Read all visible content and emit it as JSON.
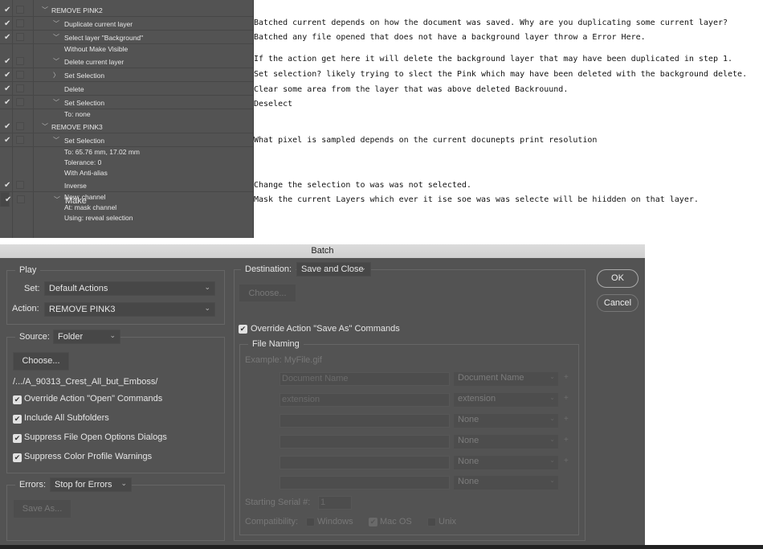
{
  "actions_panel": {
    "rows": [
      {
        "kind": "set",
        "label": "REMOVE PINK2",
        "checked": true,
        "caret": "down"
      },
      {
        "kind": "cmd",
        "label": "Duplicate current layer",
        "checked": true,
        "caret": "down"
      },
      {
        "kind": "cmd",
        "label": "Select layer \"Background\"",
        "checked": true,
        "caret": "down"
      },
      {
        "kind": "det",
        "label": "Without Make Visible"
      },
      {
        "kind": "cmd",
        "label": "Delete current layer",
        "checked": true,
        "caret": "down"
      },
      {
        "kind": "cmd",
        "label": "Set Selection",
        "checked": true,
        "caret": "right"
      },
      {
        "kind": "cmd",
        "label": "Delete",
        "checked": true,
        "caret": ""
      },
      {
        "kind": "cmd",
        "label": "Set Selection",
        "checked": true,
        "caret": "down"
      },
      {
        "kind": "det",
        "label": "To: none"
      },
      {
        "kind": "set",
        "label": "REMOVE PINK3",
        "checked": true,
        "caret": "down"
      },
      {
        "kind": "cmd",
        "label": "Set Selection",
        "checked": true,
        "caret": "down"
      },
      {
        "kind": "det",
        "label": "To: 65.76 mm, 17.02 mm"
      },
      {
        "kind": "det",
        "label": "Tolerance: 0"
      },
      {
        "kind": "det",
        "label": "With Anti-alias"
      },
      {
        "kind": "cmd",
        "label": "Inverse",
        "checked": true,
        "caret": ""
      },
      {
        "kind": "cmd",
        "label": "Make",
        "checked": true,
        "caret": "down",
        "selected": true
      },
      {
        "kind": "det",
        "label": "New: channel"
      },
      {
        "kind": "det",
        "label": "At: mask channel"
      },
      {
        "kind": "det",
        "label": "Using: reveal selection"
      }
    ]
  },
  "notes": [
    "Batched current depends on how the document was saved. Why are you duplicating some current layer?",
    "Batched any file opened that does not have a background layer throw a Error Here.",
    "If the action get here it will delete the background layer that may have been duplicated in step 1.",
    "Set selection? likely trying to slect the Pink which may have been deleted with the background delete.",
    "Clear some area from the layer that was above deleted Backrouund.",
    "Deselect",
    "What pixel is sampled depends on the current docunepts print resolution",
    "Change the selection to was was not selected.",
    "Mask the current Layers  which ever it ise soe was was selecte will be hiidden on that layer."
  ],
  "dialog": {
    "title": "Batch",
    "play": {
      "label": "Play",
      "set_label": "Set:",
      "set_value": "Default Actions",
      "action_label": "Action:",
      "action_value": "REMOVE PINK3"
    },
    "source": {
      "label": "Source:",
      "value": "Folder",
      "choose": "Choose...",
      "path": "/.../A_90313_Crest_All_but_Emboss/",
      "checkboxes": [
        {
          "label": "Override Action \"Open\" Commands",
          "checked": true
        },
        {
          "label": "Include All Subfolders",
          "checked": true
        },
        {
          "label": "Suppress File Open Options Dialogs",
          "checked": true
        },
        {
          "label": "Suppress Color Profile Warnings",
          "checked": true
        }
      ]
    },
    "errors": {
      "label": "Errors:",
      "value": "Stop for Errors",
      "save_as": "Save As..."
    },
    "destination": {
      "label": "Destination:",
      "value": "Save and Close",
      "choose": "Choose...",
      "override_label": "Override Action \"Save As\" Commands",
      "override_checked": true
    },
    "file_naming": {
      "label": "File Naming",
      "example": "Example: MyFile.gif",
      "rows": [
        {
          "text": "Document Name",
          "select": "Document Name",
          "plus": "+"
        },
        {
          "text": "extension",
          "select": "extension",
          "plus": "+"
        },
        {
          "text": "",
          "select": "None",
          "plus": "+"
        },
        {
          "text": "",
          "select": "None",
          "plus": "+"
        },
        {
          "text": "",
          "select": "None",
          "plus": "+"
        },
        {
          "text": "",
          "select": "None",
          "plus": ""
        }
      ],
      "serial_label": "Starting Serial #:",
      "serial_value": "1",
      "compat_label": "Compatibility:",
      "compat": [
        {
          "label": "Windows",
          "checked": false
        },
        {
          "label": "Mac OS",
          "checked": true
        },
        {
          "label": "Unix",
          "checked": false
        }
      ]
    },
    "ok": "OK",
    "cancel": "Cancel"
  }
}
